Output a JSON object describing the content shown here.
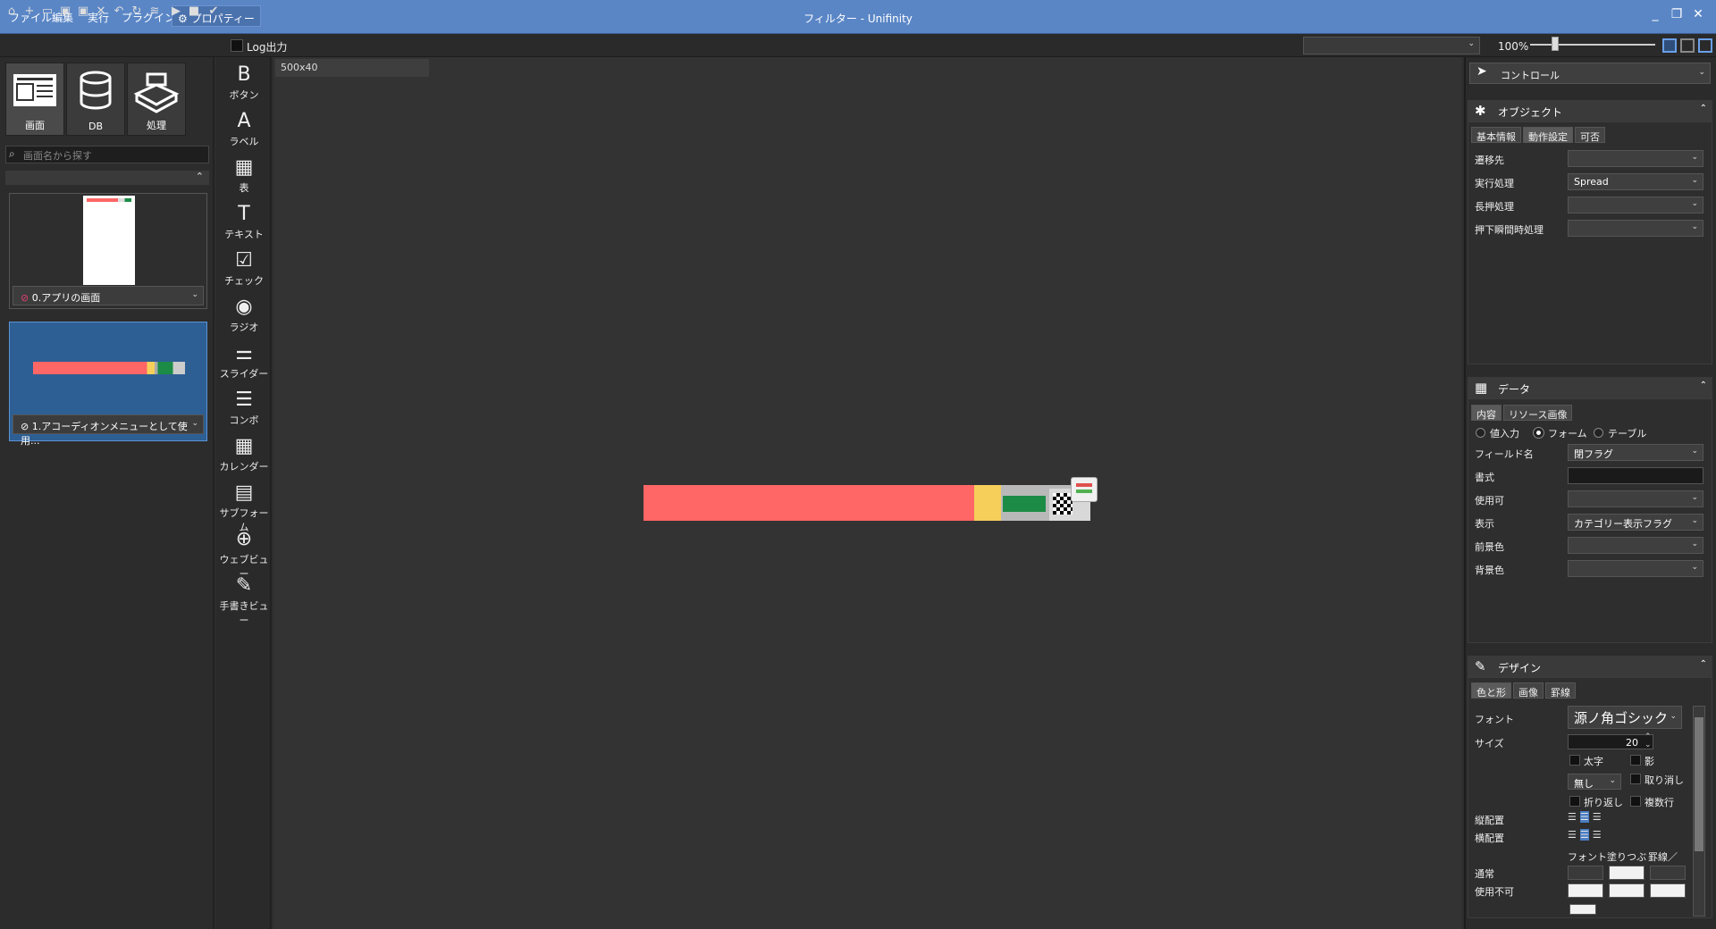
{
  "menu": {
    "file": "ファイル",
    "edit": "編集",
    "run": "実行",
    "plugin": "プラグイン",
    "property": "⚙ プロパティー"
  },
  "window": {
    "title": "フィルター - Unifinity"
  },
  "toolbar": {
    "log_label": "Log出力",
    "zoom": "100%",
    "zoom_level": 0.2
  },
  "left": {
    "categories": [
      "画面",
      "DB",
      "処理"
    ],
    "search_placeholder": "画面名から探す",
    "screens": [
      "0.アプリの画面",
      "1.アコーディオンメニューとして使用..."
    ]
  },
  "tools": [
    "ボタン",
    "ラベル",
    "表",
    "テキスト",
    "チェック",
    "ラジオ",
    "スライダー",
    "コンボ",
    "カレンダー",
    "サブフォーム",
    "ウェブビュー",
    "手書きビュー"
  ],
  "tool_glyphs": [
    "B",
    "A",
    "▦",
    "T",
    "☑",
    "◉",
    "⚌",
    "☰",
    "▦",
    "▤",
    "⊕",
    "✎"
  ],
  "canvas": {
    "tab": "500x40"
  },
  "right": {
    "control_select": "コントロール",
    "object": {
      "title": "オブジェクト",
      "tabs": [
        "基本情報",
        "動作設定",
        "可否"
      ],
      "props": [
        {
          "label": "遷移先",
          "value": ""
        },
        {
          "label": "実行処理",
          "value": "Spread"
        },
        {
          "label": "長押処理",
          "value": ""
        },
        {
          "label": "押下瞬間時処理",
          "value": ""
        }
      ]
    },
    "data": {
      "title": "データ",
      "tabs": [
        "内容",
        "リソース画像"
      ],
      "radios": [
        "値入力",
        "フォーム",
        "テーブル"
      ],
      "props": [
        {
          "label": "フィールド名",
          "value": "閉フラグ"
        },
        {
          "label": "書式",
          "value": ""
        },
        {
          "label": "使用可",
          "value": ""
        },
        {
          "label": "表示",
          "value": "カテゴリー表示フラグ"
        },
        {
          "label": "前景色",
          "value": ""
        },
        {
          "label": "背景色",
          "value": ""
        }
      ]
    },
    "design": {
      "title": "デザイン",
      "tabs": [
        "色と形",
        "画像",
        "罫線"
      ],
      "font_label": "フォント",
      "font_value": "源ノ角ゴシック",
      "size_label": "サイズ",
      "size_value": "20",
      "bold": "太字",
      "shadow": "影",
      "underline_sel": "無し",
      "strike": "取り消し",
      "wrap": "折り返し",
      "multiline": "複数行",
      "valign": "縦配置",
      "halign": "横配置",
      "col_font": "フォント",
      "col_fill": "塗りつぶ",
      "col_border": "罫線／",
      "row_normal": "通常",
      "row_disabled": "使用不可"
    }
  }
}
